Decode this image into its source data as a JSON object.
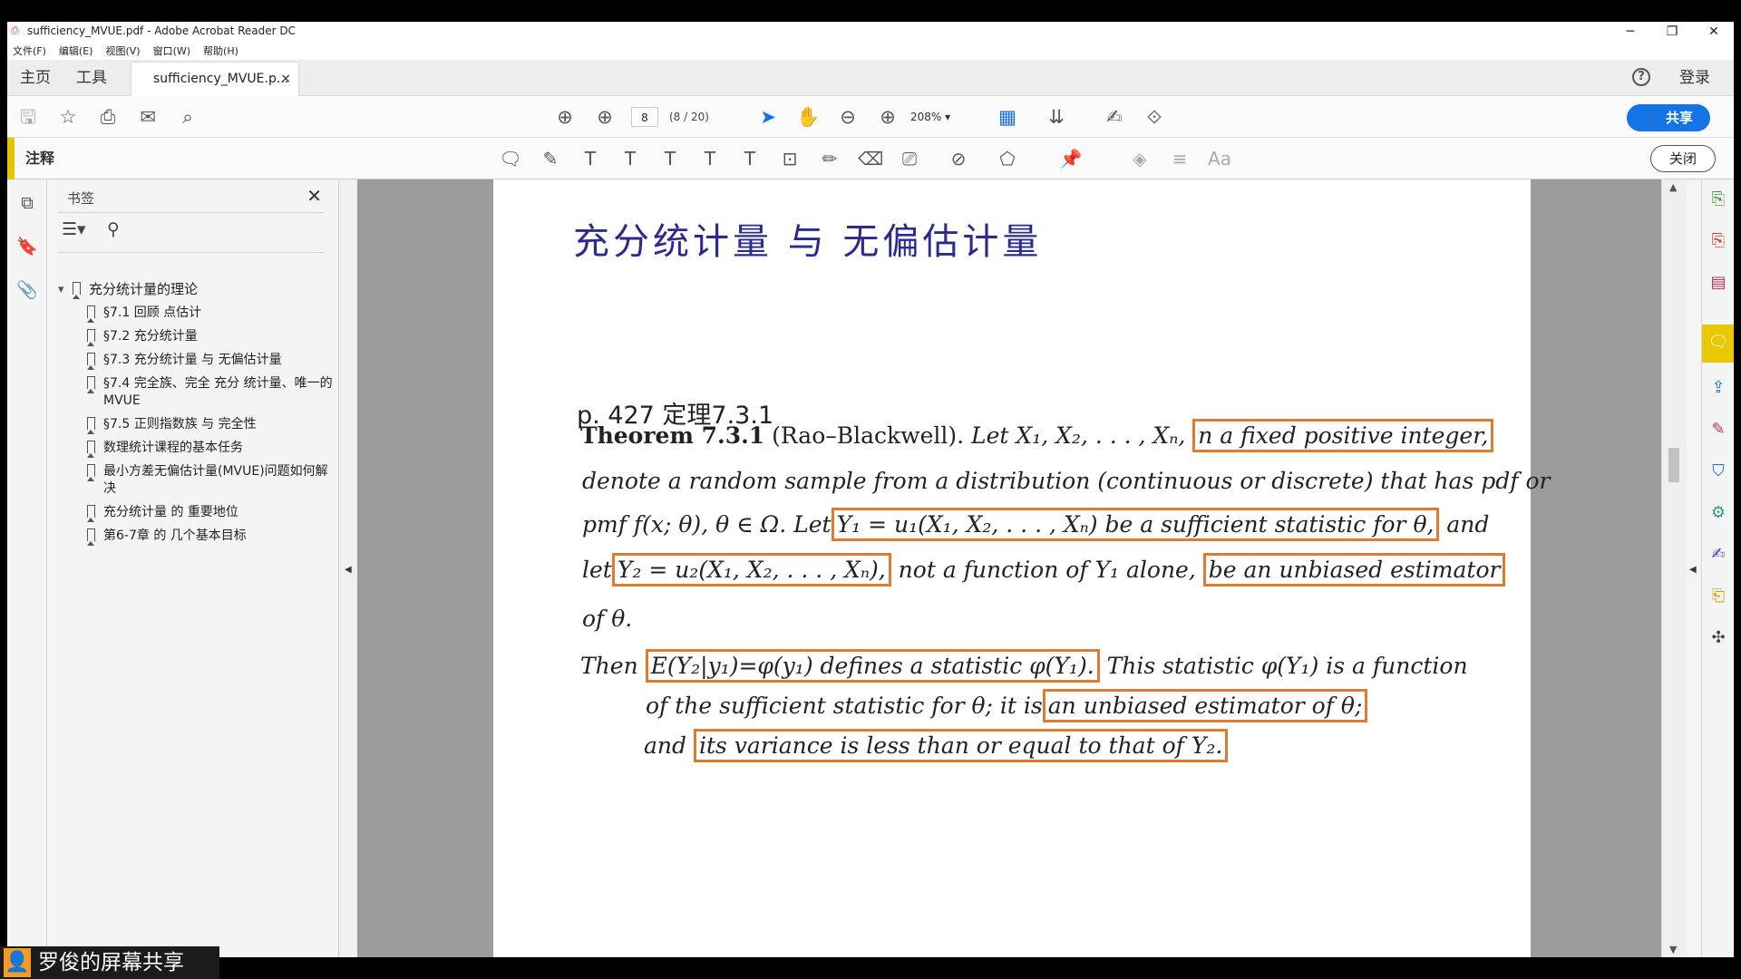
{
  "window": {
    "title": "sufficiency_MVUE.pdf - Adobe Acrobat Reader DC",
    "controls": [
      "─",
      "❐",
      "✕"
    ]
  },
  "menu": [
    "文件(F)",
    "编辑(E)",
    "视图(V)",
    "窗口(W)",
    "帮助(H)"
  ],
  "tabs": {
    "home": "主页",
    "tools": "工具",
    "document": "sufficiency_MVUE.p...",
    "close": "×",
    "help": "?",
    "login": "登录"
  },
  "toolbar": {
    "page_number": "8",
    "page_count": "(8 / 20)",
    "zoom": "208%",
    "share": "共享"
  },
  "annotation": {
    "label": "注释",
    "text_aa": "Aa",
    "close": "关闭"
  },
  "bookmarks": {
    "title": "书签",
    "close": "✕",
    "root": "充分统计量的理论",
    "items": [
      "§7.1 回顾 点估计",
      "§7.2 充分统计量",
      "§7.3 充分统计量 与 无偏估计量",
      "§7.4 完全族、完全 充分 统计量、唯一的MVUE",
      "§7.5 正则指数族 与 完全性",
      "数理统计课程的基本任务",
      "最小方差无偏估计量(MVUE)问题如何解决",
      "充分统计量 的 重要地位",
      "第6-7章 的 几个基本目标"
    ]
  },
  "page": {
    "title": "充分统计量 与 无偏估计量",
    "reference": "p. 427 定理7.3.1",
    "theorem_label": "Theorem 7.3.1",
    "theorem_name": "(Rao–Blackwell).",
    "l1_a": "Let X₁, X₂, . . . , Xₙ,",
    "l1_box": "n a fixed positive integer,",
    "l2": "denote a random sample from a distribution (continuous or discrete) that has pdf or",
    "l3_a": "pmf f(x; θ), θ ∈ Ω. Let",
    "l3_box": "Y₁ = u₁(X₁, X₂, . . . , Xₙ) be a sufficient statistic for θ,",
    "l3_b": "and",
    "l4_a": "let",
    "l4_box1": "Y₂ = u₂(X₁, X₂, . . . , Xₙ),",
    "l4_b": "not a function of Y₁ alone,",
    "l4_box2": "be an unbiased estimator",
    "l5": "of θ.",
    "l6_a": "Then",
    "l6_box": "E(Y₂|y₁)=φ(y₁) defines a statistic φ(Y₁).",
    "l6_b": "This statistic φ(Y₁) is a function",
    "l7_a": "of the sufficient statistic for θ; it is",
    "l7_box": "an unbiased estimator of θ;",
    "l8_a": "and",
    "l8_box": "its  variance is less than or equal to that of Y₂."
  },
  "overlay": {
    "screen_share": "罗俊的屏幕共享"
  },
  "colors": {
    "accent_blue": "#1473e6",
    "title_blue": "#2a2a90",
    "highlight_box": "#e07a2e",
    "annotation_yellow": "#e6c400"
  }
}
